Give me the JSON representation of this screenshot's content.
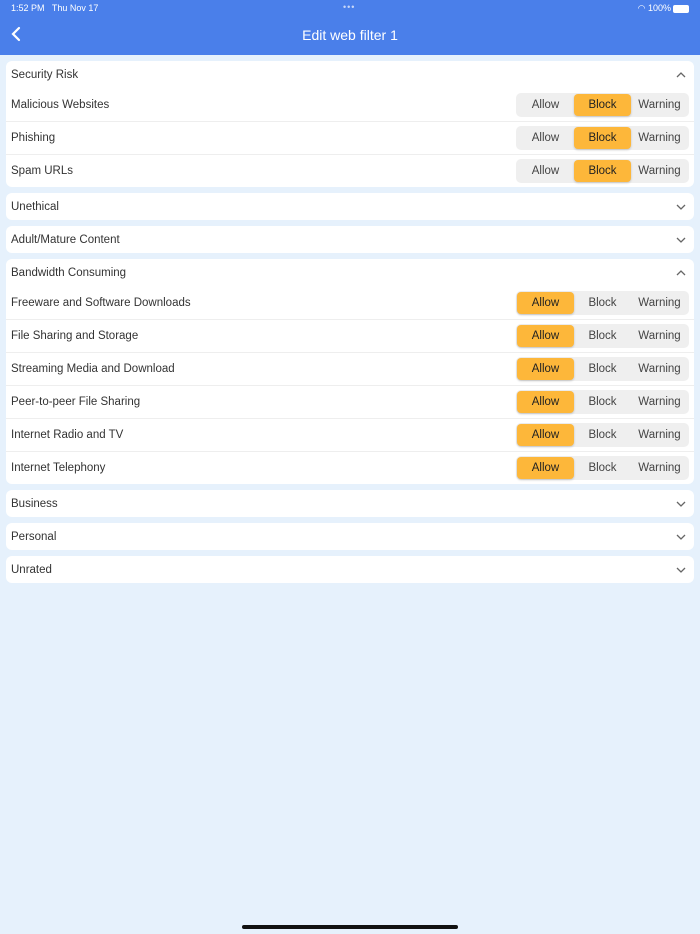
{
  "status": {
    "time": "1:52 PM",
    "date": "Thu Nov 17",
    "battery": "100%"
  },
  "header": {
    "title": "Edit web filter 1"
  },
  "options": [
    "Allow",
    "Block",
    "Warning"
  ],
  "sections": [
    {
      "title": "Security Risk",
      "expanded": true,
      "items": [
        {
          "label": "Malicious Websites",
          "value": "Block"
        },
        {
          "label": "Phishing",
          "value": "Block"
        },
        {
          "label": "Spam URLs",
          "value": "Block"
        }
      ]
    },
    {
      "title": "Unethical",
      "expanded": false,
      "items": []
    },
    {
      "title": "Adult/Mature Content",
      "expanded": false,
      "items": []
    },
    {
      "title": "Bandwidth Consuming",
      "expanded": true,
      "items": [
        {
          "label": "Freeware and Software Downloads",
          "value": "Allow"
        },
        {
          "label": "File Sharing and Storage",
          "value": "Allow"
        },
        {
          "label": "Streaming Media and Download",
          "value": "Allow"
        },
        {
          "label": "Peer-to-peer File Sharing",
          "value": "Allow"
        },
        {
          "label": "Internet Radio and TV",
          "value": "Allow"
        },
        {
          "label": "Internet Telephony",
          "value": "Allow"
        }
      ]
    },
    {
      "title": "Business",
      "expanded": false,
      "items": []
    },
    {
      "title": "Personal",
      "expanded": false,
      "items": []
    },
    {
      "title": "Unrated",
      "expanded": false,
      "items": []
    }
  ],
  "colors": {
    "header": "#4a7fea",
    "selected": "#fdb73a",
    "background": "#e6f1fc"
  }
}
